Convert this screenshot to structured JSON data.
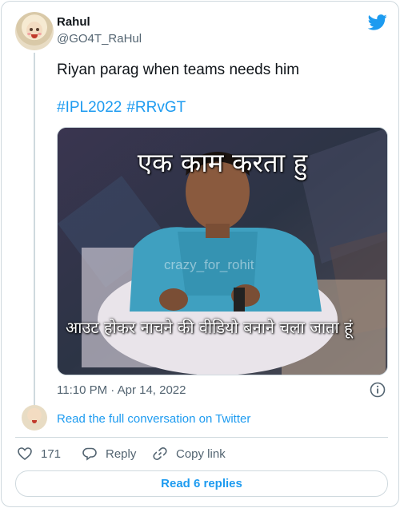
{
  "author": {
    "display_name": "Rahul",
    "handle": "@GO4T_RaHul"
  },
  "tweet": {
    "text": "Riyan parag when teams needs him",
    "hashtags": [
      "#IPL2022",
      "#RRvGT"
    ],
    "timestamp": "11:10 PM · Apr 14, 2022"
  },
  "media": {
    "caption_top": "एक काम करता हु",
    "caption_bottom": "आउट होकर नाचने की वीडियो बनाने चला जाता हूं",
    "watermark": "crazy_for_rohit"
  },
  "conversation_link": "Read the full conversation on Twitter",
  "actions": {
    "like_count": "171",
    "reply_label": "Reply",
    "copy_label": "Copy link"
  },
  "read_replies_label": "Read 6 replies",
  "icons": {
    "logo": "twitter-bird-icon",
    "info": "info-icon",
    "like": "heart-icon",
    "reply": "speech-bubble-icon",
    "copy": "link-icon"
  },
  "colors": {
    "accent": "#1d9bf0",
    "secondary_text": "#536471",
    "border": "#cfd9de"
  }
}
